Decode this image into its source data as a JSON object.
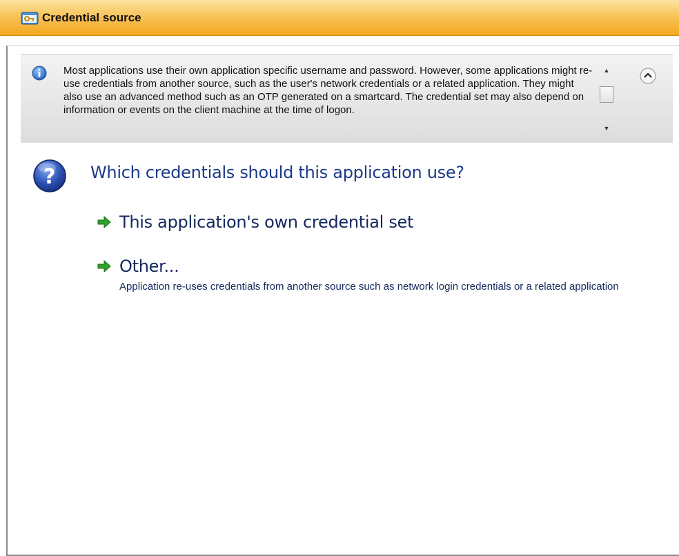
{
  "header": {
    "title": "Credential source",
    "icon": "key-window-icon"
  },
  "info": {
    "icon": "info-icon",
    "text": "Most applications use their own application specific username and password. However, some applications might re-use credentials from another source, such as the user's network credentials or a related application. They might also use an advanced method such as an OTP generated on a smartcard. The credential set may also depend on information or events on the client machine at the time of logon."
  },
  "question": {
    "icon": "question-icon",
    "text": "Which credentials should this application use?"
  },
  "options": [
    {
      "label": "This application's own credential set",
      "icon": "green-arrow-icon"
    },
    {
      "label": "Other...",
      "description": "Application re-uses credentials from another source such as network login credentials or a related application",
      "icon": "green-arrow-icon"
    }
  ],
  "colors": {
    "title_bar_top": "#fde3a0",
    "title_bar_bottom": "#f2a81c",
    "link_blue": "#1c3a8a",
    "arrow_green": "#2fa32a"
  }
}
